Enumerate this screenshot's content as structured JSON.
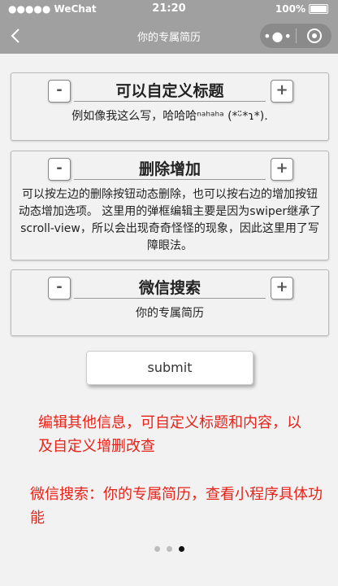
{
  "statusbar": {
    "carrier": "●●●●● WeChat",
    "time": "21:20",
    "battery": "100%"
  },
  "navbar": {
    "title": "你的专属简历"
  },
  "cards": [
    {
      "title": "可以自定义标题",
      "body": "例如像我这么写，哈哈哈ⁿᵃʰᵃʰᵃ (*ᵕ̈*ɿ*)."
    },
    {
      "title": "删除增加",
      "body": "可以按左边的删除按钮动态删除，也可以按右边的增加按钮动态增加选项。 这里用的弹框编辑主要是因为swiper继承了scroll-view，所以会出现奇奇怪怪的现象，因此这里用了写障眼法。"
    },
    {
      "title": "微信搜索",
      "body": "你的专属简历"
    }
  ],
  "buttons": {
    "minus": "-",
    "plus": "+"
  },
  "submit_label": "submit",
  "notes": {
    "line1": "编辑其他信息，可自定义标题和内容，以及自定义增删改查",
    "line2": "微信搜索：你的专属简历，查看小程序具体功能"
  },
  "pager": {
    "count": 3,
    "active_index": 2
  },
  "colors": {
    "navbar": "#a0a0a0",
    "note_red": "#e8231a",
    "page_bg": "#f2f2f2"
  }
}
